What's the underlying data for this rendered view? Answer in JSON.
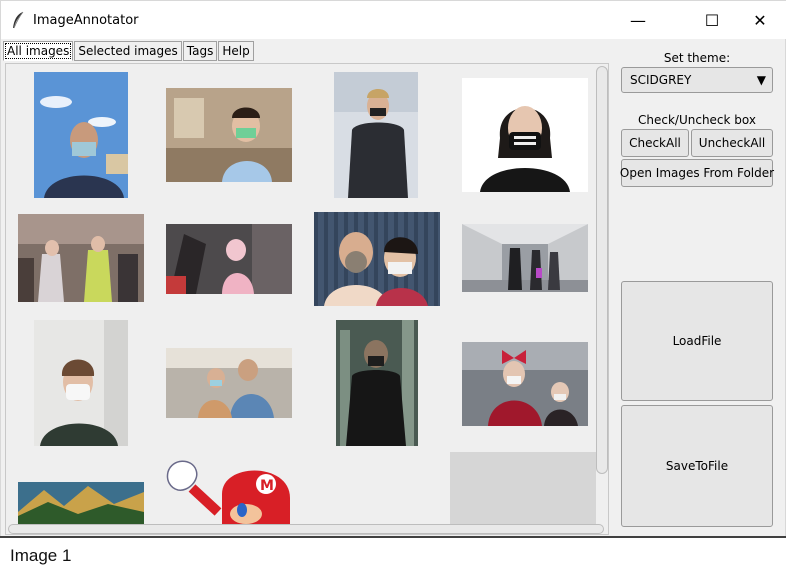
{
  "window": {
    "title": "ImageAnnotator",
    "controls": {
      "minimize": "—",
      "maximize": "☐",
      "close": "✕"
    }
  },
  "tabs": [
    {
      "label": "All images",
      "active": true
    },
    {
      "label": "Selected images",
      "active": false
    },
    {
      "label": "Tags",
      "active": false
    },
    {
      "label": "Help",
      "active": false
    }
  ],
  "sidebar": {
    "theme_label": "Set theme:",
    "theme_value": "SCIDGREY",
    "check_label": "Check/Uncheck box",
    "check_all": "CheckAll",
    "uncheck_all": "UncheckAll",
    "open_folder": "Open Images From Folder",
    "load_file": "LoadFile",
    "save_file": "SaveToFile"
  },
  "gallery": {
    "images": [
      {
        "name": "man-blue-sky-mask"
      },
      {
        "name": "girl-green-mask"
      },
      {
        "name": "woman-jacket-mask"
      },
      {
        "name": "woman-skull-mask"
      },
      {
        "name": "street-crowd-masks"
      },
      {
        "name": "stroller-child"
      },
      {
        "name": "couple-gas-mask"
      },
      {
        "name": "subway-walkers"
      },
      {
        "name": "woman-white-mask"
      },
      {
        "name": "parent-child-airport"
      },
      {
        "name": "man-train-mask"
      },
      {
        "name": "girls-bow-masks"
      },
      {
        "name": "mountain-landscape"
      },
      {
        "name": "cartoon-plumber"
      }
    ]
  },
  "caption": "Image 1",
  "colors": {
    "window_bg": "#f0f0f0",
    "button_bg": "#e6e6e6",
    "panel_bg": "#efefef"
  }
}
